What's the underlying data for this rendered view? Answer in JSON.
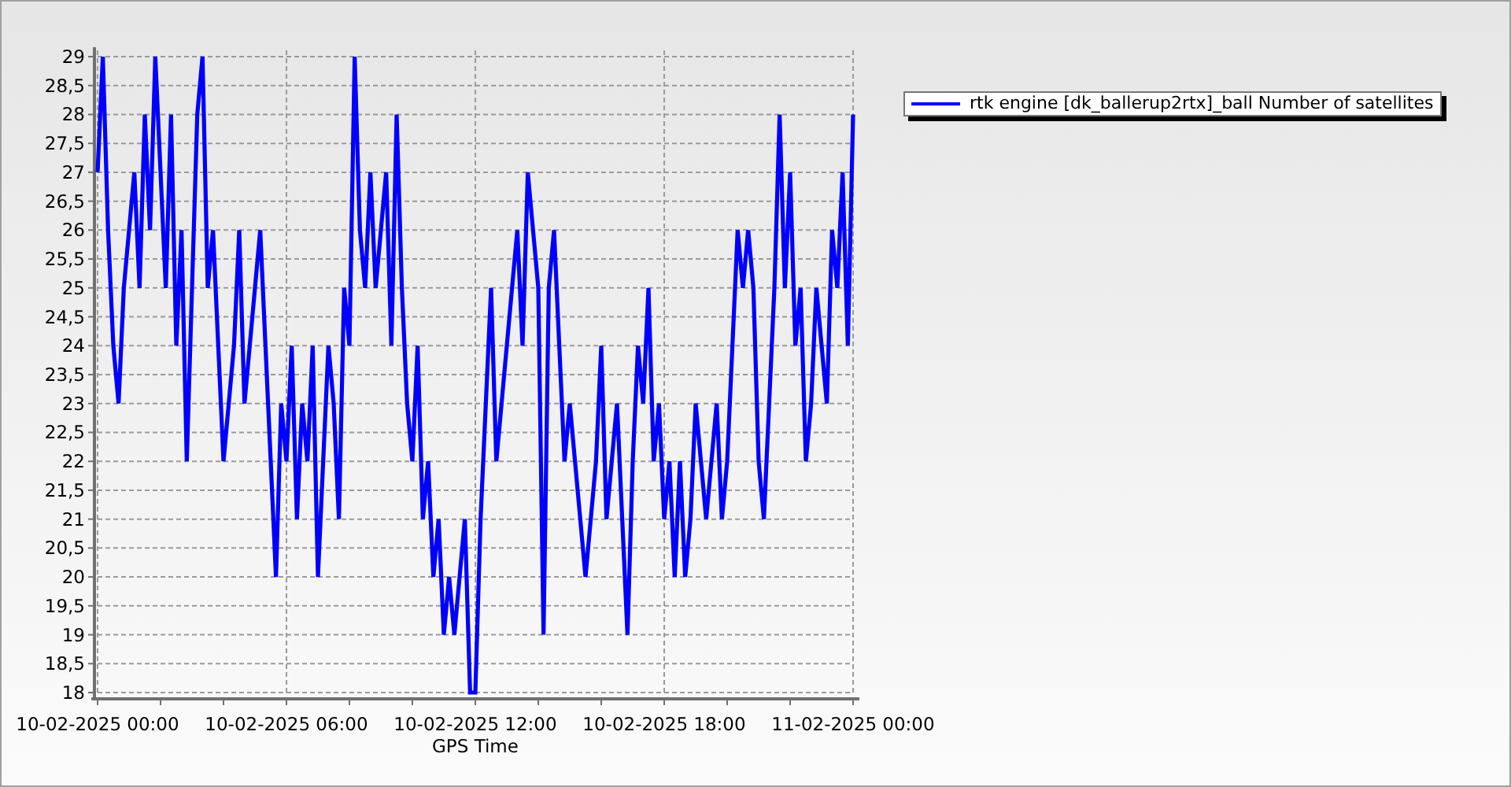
{
  "chart_data": {
    "type": "line",
    "xlabel": "GPS Time",
    "categories": [
      "10-02-2025 00:00",
      null,
      null,
      null,
      null,
      null,
      null,
      null,
      null,
      null,
      null,
      null,
      null,
      null,
      null,
      null,
      null,
      null,
      null,
      null,
      null,
      null,
      null,
      null,
      null,
      null,
      null,
      null,
      null,
      null,
      null,
      null,
      null,
      null,
      null,
      null,
      "10-02-2025 06:00",
      null,
      null,
      null,
      null,
      null,
      null,
      null,
      null,
      null,
      null,
      null,
      null,
      null,
      null,
      null,
      null,
      null,
      null,
      null,
      null,
      null,
      null,
      null,
      null,
      null,
      null,
      null,
      null,
      null,
      null,
      null,
      null,
      null,
      null,
      null,
      "10-02-2025 12:00",
      null,
      null,
      null,
      null,
      null,
      null,
      null,
      null,
      null,
      null,
      null,
      null,
      null,
      null,
      null,
      null,
      null,
      null,
      null,
      null,
      null,
      null,
      null,
      null,
      null,
      null,
      null,
      null,
      null,
      null,
      null,
      null,
      null,
      null,
      null,
      "10-02-2025 18:00",
      null,
      null,
      null,
      null,
      null,
      null,
      null,
      null,
      null,
      null,
      null,
      null,
      null,
      null,
      null,
      null,
      null,
      null,
      null,
      null,
      null,
      null,
      null,
      null,
      null,
      null,
      null,
      null,
      null,
      null,
      null,
      null,
      null,
      null,
      null,
      "11-02-2025 00:00"
    ],
    "series": [
      {
        "name": "rtk engine [dk_ballerup2rtx]_ball Number of satellites",
        "color": "#0000ff",
        "values": [
          27,
          29,
          26,
          24,
          23,
          25,
          26,
          27,
          25,
          28,
          26,
          29,
          27,
          25,
          28,
          24,
          26,
          22,
          25,
          28,
          29,
          25,
          26,
          24,
          22,
          23,
          24,
          26,
          23,
          24,
          25,
          26,
          24,
          22,
          20,
          23,
          22,
          24,
          21,
          23,
          22,
          24,
          20,
          22,
          24,
          23,
          21,
          25,
          24,
          29,
          26,
          25,
          27,
          25,
          26,
          27,
          24,
          28,
          25,
          23,
          22,
          24,
          21,
          22,
          20,
          21,
          19,
          20,
          19,
          20,
          21,
          18,
          18,
          21,
          23,
          25,
          22,
          23,
          24,
          25,
          26,
          24,
          27,
          26,
          25,
          19,
          25,
          26,
          24,
          22,
          23,
          22,
          21,
          20,
          21,
          22,
          24,
          21,
          22,
          23,
          21,
          19,
          22,
          24,
          23,
          25,
          22,
          23,
          21,
          22,
          20,
          22,
          20,
          21,
          23,
          22,
          21,
          22,
          23,
          21,
          22,
          24,
          26,
          25,
          26,
          25,
          22,
          21,
          23,
          25,
          28,
          25,
          27,
          24,
          25,
          22,
          23,
          25,
          24,
          23,
          26,
          25,
          27,
          24,
          28
        ]
      }
    ],
    "ylim": [
      18,
      29
    ],
    "grid": true,
    "yticks": [
      18,
      {
        "value": 18.5,
        "label": "18,5"
      },
      19,
      {
        "value": 19.5,
        "label": "19,5"
      },
      20,
      {
        "value": 20.5,
        "label": "20,5"
      },
      21,
      {
        "value": 21.5,
        "label": "21,5"
      },
      22,
      {
        "value": 22.5,
        "label": "22,5"
      },
      23,
      {
        "value": 23.5,
        "label": "23,5"
      },
      24,
      {
        "value": 24.5,
        "label": "24,5"
      },
      25,
      {
        "value": 25.5,
        "label": "25,5"
      },
      26,
      {
        "value": 26.5,
        "label": "26,5"
      },
      27,
      {
        "value": 27.5,
        "label": "27,5"
      },
      28,
      {
        "value": 28.5,
        "label": "28,5"
      },
      29
    ]
  }
}
